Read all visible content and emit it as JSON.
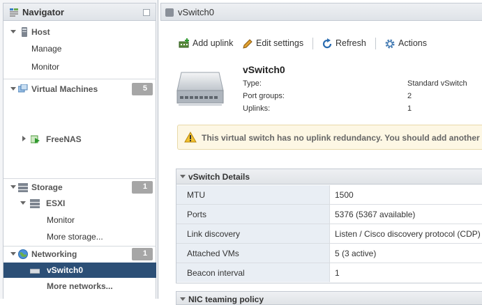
{
  "navigator": {
    "title": "Navigator",
    "host": {
      "label": "Host",
      "children": [
        "Manage",
        "Monitor"
      ]
    },
    "vms": {
      "label": "Virtual Machines",
      "count": "5",
      "children": [
        "FreeNAS"
      ]
    },
    "storage": {
      "label": "Storage",
      "count": "1",
      "child": "ESXI",
      "children": [
        "Monitor",
        "More storage..."
      ]
    },
    "networking": {
      "label": "Networking",
      "count": "1",
      "selected": "vSwitch0",
      "more": "More networks..."
    }
  },
  "main": {
    "title": "vSwitch0",
    "toolbar": {
      "add_uplink": "Add uplink",
      "edit_settings": "Edit settings",
      "refresh": "Refresh",
      "actions": "Actions"
    },
    "summary": {
      "name": "vSwitch0",
      "fields": [
        {
          "label": "Type:",
          "value": "Standard vSwitch"
        },
        {
          "label": "Port groups:",
          "value": "2"
        },
        {
          "label": "Uplinks:",
          "value": "1"
        }
      ]
    },
    "warning": "This virtual switch has no uplink redundancy. You should add another up",
    "details": {
      "title": "vSwitch Details",
      "rows": [
        {
          "label": "MTU",
          "value": "1500"
        },
        {
          "label": "Ports",
          "value": "5376 (5367 available)"
        },
        {
          "label": "Link discovery",
          "value": "Listen / Cisco discovery protocol (CDP)"
        },
        {
          "label": "Attached VMs",
          "value": "5 (3 active)"
        },
        {
          "label": "Beacon interval",
          "value": "1"
        }
      ]
    },
    "nic_teaming": {
      "title": "NIC teaming policy"
    }
  },
  "colors": {
    "selected_bg": "#2c4f76",
    "badge_bg": "#a6a6a6",
    "warning_bg": "#fdf7e4"
  }
}
